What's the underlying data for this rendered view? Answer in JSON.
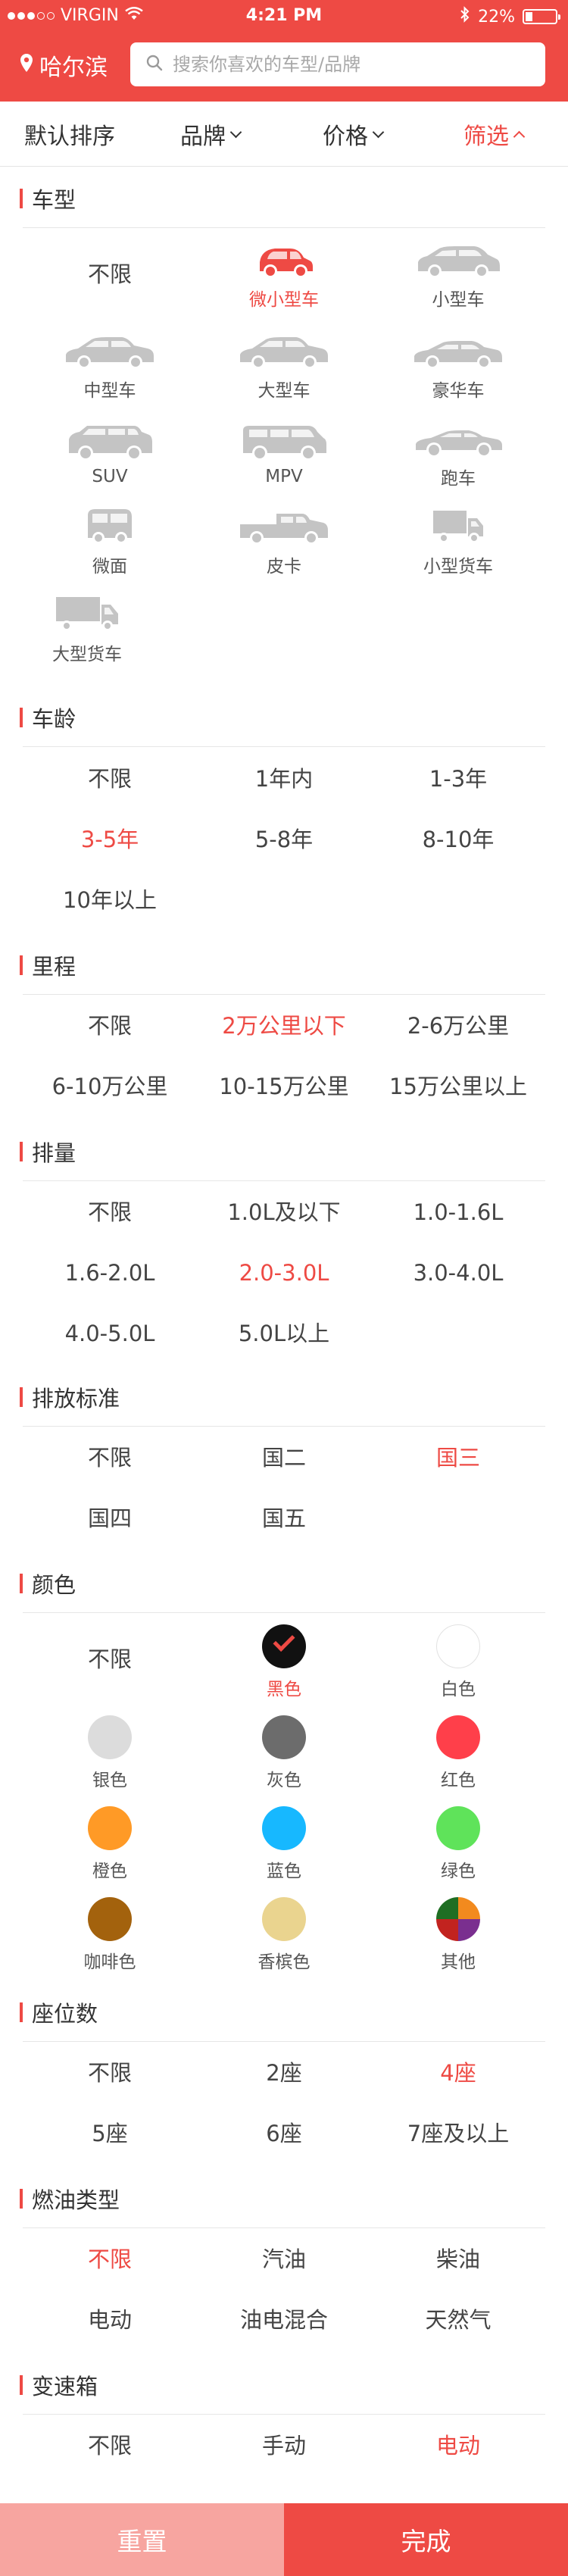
{
  "status_bar": {
    "carrier": "VIRGIN",
    "time": "4:21 PM",
    "battery": "22%"
  },
  "header": {
    "city": "哈尔滨",
    "search_placeholder": "搜索你喜欢的车型/品牌"
  },
  "sort_bar": [
    {
      "label": "默认排序",
      "arrow": false,
      "active": false
    },
    {
      "label": "品牌",
      "arrow": "down",
      "active": false
    },
    {
      "label": "价格",
      "arrow": "down",
      "active": false
    },
    {
      "label": "筛选",
      "arrow": "up",
      "active": true
    }
  ],
  "car_type": {
    "title": "车型",
    "items": [
      {
        "label": "不限",
        "icon": null,
        "active": false
      },
      {
        "label": "微小型车",
        "icon": "mini-car-icon",
        "active": true
      },
      {
        "label": "小型车",
        "icon": "small-car-icon",
        "active": false
      },
      {
        "label": "中型车",
        "icon": "midsize-car-icon",
        "active": false
      },
      {
        "label": "大型车",
        "icon": "large-car-icon",
        "active": false
      },
      {
        "label": "豪华车",
        "icon": "luxury-car-icon",
        "active": false
      },
      {
        "label": "SUV",
        "icon": "suv-icon",
        "active": false
      },
      {
        "label": "MPV",
        "icon": "mpv-icon",
        "active": false
      },
      {
        "label": "跑车",
        "icon": "sports-car-icon",
        "active": false
      },
      {
        "label": "微面",
        "icon": "microvan-icon",
        "active": false
      },
      {
        "label": "皮卡",
        "icon": "pickup-icon",
        "active": false
      },
      {
        "label": "小型货车",
        "icon": "small-truck-icon",
        "active": false
      },
      {
        "label": "大型货车",
        "icon": "large-truck-icon",
        "active": false
      }
    ]
  },
  "car_age": {
    "title": "车龄",
    "options": [
      {
        "label": "不限",
        "active": false
      },
      {
        "label": "1年内",
        "active": false
      },
      {
        "label": "1-3年",
        "active": false
      },
      {
        "label": "3-5年",
        "active": true
      },
      {
        "label": "5-8年",
        "active": false
      },
      {
        "label": "8-10年",
        "active": false
      },
      {
        "label": "10年以上",
        "active": false
      }
    ]
  },
  "mileage": {
    "title": "里程",
    "options": [
      {
        "label": "不限",
        "active": false
      },
      {
        "label": "2万公里以下",
        "active": true
      },
      {
        "label": "2-6万公里",
        "active": false
      },
      {
        "label": "6-10万公里",
        "active": false
      },
      {
        "label": "10-15万公里",
        "active": false
      },
      {
        "label": "15万公里以上",
        "active": false
      }
    ]
  },
  "displacement": {
    "title": "排量",
    "options": [
      {
        "label": "不限",
        "active": false
      },
      {
        "label": "1.0L及以下",
        "active": false
      },
      {
        "label": "1.0-1.6L",
        "active": false
      },
      {
        "label": "1.6-2.0L",
        "active": false
      },
      {
        "label": "2.0-3.0L",
        "active": true
      },
      {
        "label": "3.0-4.0L",
        "active": false
      },
      {
        "label": "4.0-5.0L",
        "active": false
      },
      {
        "label": "5.0L以上",
        "active": false
      }
    ]
  },
  "emission": {
    "title": "排放标准",
    "options": [
      {
        "label": "不限",
        "active": false
      },
      {
        "label": "国二",
        "active": false
      },
      {
        "label": "国三",
        "active": true
      },
      {
        "label": "国四",
        "active": false
      },
      {
        "label": "国五",
        "active": false
      }
    ]
  },
  "color": {
    "title": "颜色",
    "none_label": "不限",
    "items": [
      {
        "label": "黑色",
        "hex": "#111111",
        "active": true
      },
      {
        "label": "白色",
        "hex": "#ffffff",
        "active": false
      },
      {
        "label": "银色",
        "hex": "#dcdcdc",
        "active": false
      },
      {
        "label": "灰色",
        "hex": "#6c6c6c",
        "active": false
      },
      {
        "label": "红色",
        "hex": "#ff3f4a",
        "active": false
      },
      {
        "label": "橙色",
        "hex": "#ff9a26",
        "active": false
      },
      {
        "label": "蓝色",
        "hex": "#17b8ff",
        "active": false
      },
      {
        "label": "绿色",
        "hex": "#5fe35a",
        "active": false
      },
      {
        "label": "咖啡色",
        "hex": "#a3620d",
        "active": false
      },
      {
        "label": "香槟色",
        "hex": "#ead48f",
        "active": false
      },
      {
        "label": "其他",
        "hex": "multi",
        "active": false
      }
    ]
  },
  "seats": {
    "title": "座位数",
    "options": [
      {
        "label": "不限",
        "active": false
      },
      {
        "label": "2座",
        "active": false
      },
      {
        "label": "4座",
        "active": true
      },
      {
        "label": "5座",
        "active": false
      },
      {
        "label": "6座",
        "active": false
      },
      {
        "label": "7座及以上",
        "active": false
      }
    ]
  },
  "fuel": {
    "title": "燃油类型",
    "options": [
      {
        "label": "不限",
        "active": true
      },
      {
        "label": "汽油",
        "active": false
      },
      {
        "label": "柴油",
        "active": false
      },
      {
        "label": "电动",
        "active": false
      },
      {
        "label": "油电混合",
        "active": false
      },
      {
        "label": "天然气",
        "active": false
      }
    ]
  },
  "transmission": {
    "title": "变速箱",
    "options": [
      {
        "label": "不限",
        "active": false
      },
      {
        "label": "手动",
        "active": false
      },
      {
        "label": "电动",
        "active": true
      }
    ]
  },
  "footer": {
    "reset_label": "重置",
    "done_label": "完成"
  },
  "colors": {
    "accent": "#ee4a44",
    "accent_light": "#f7a5a0",
    "icon_gray": "#c4c4c4"
  }
}
